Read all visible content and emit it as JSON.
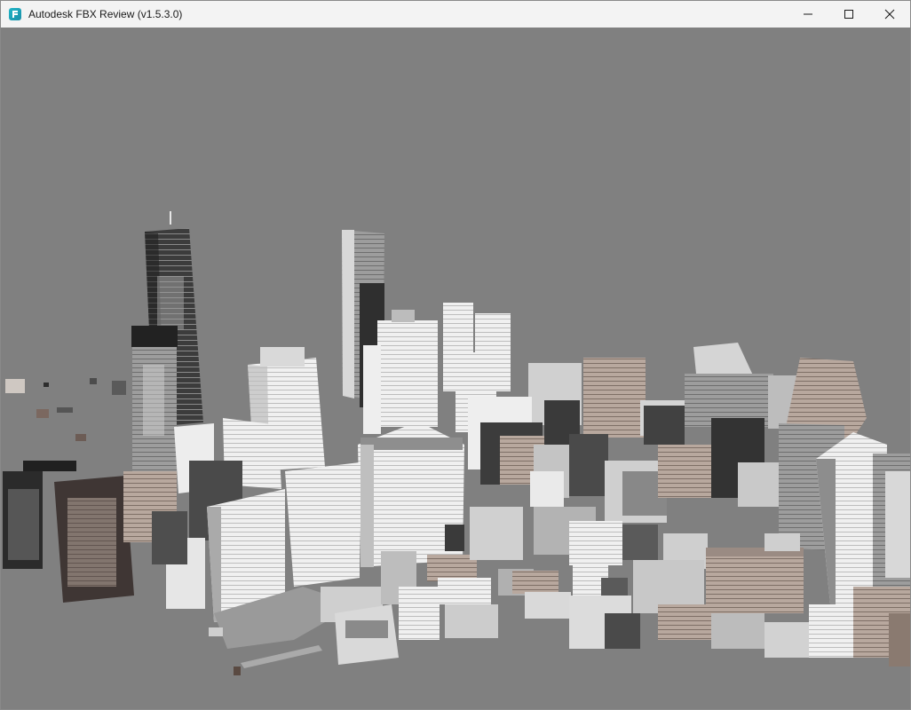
{
  "window": {
    "title": "Autodesk FBX Review (v1.5.3.0)",
    "app_icon": "fbx-review-app-icon",
    "controls": {
      "minimize_icon": "minimize-icon",
      "maximize_icon": "maximize-icon",
      "close_icon": "close-icon"
    }
  },
  "viewport": {
    "background_color": "#808080",
    "scene": "3d-city-model"
  }
}
